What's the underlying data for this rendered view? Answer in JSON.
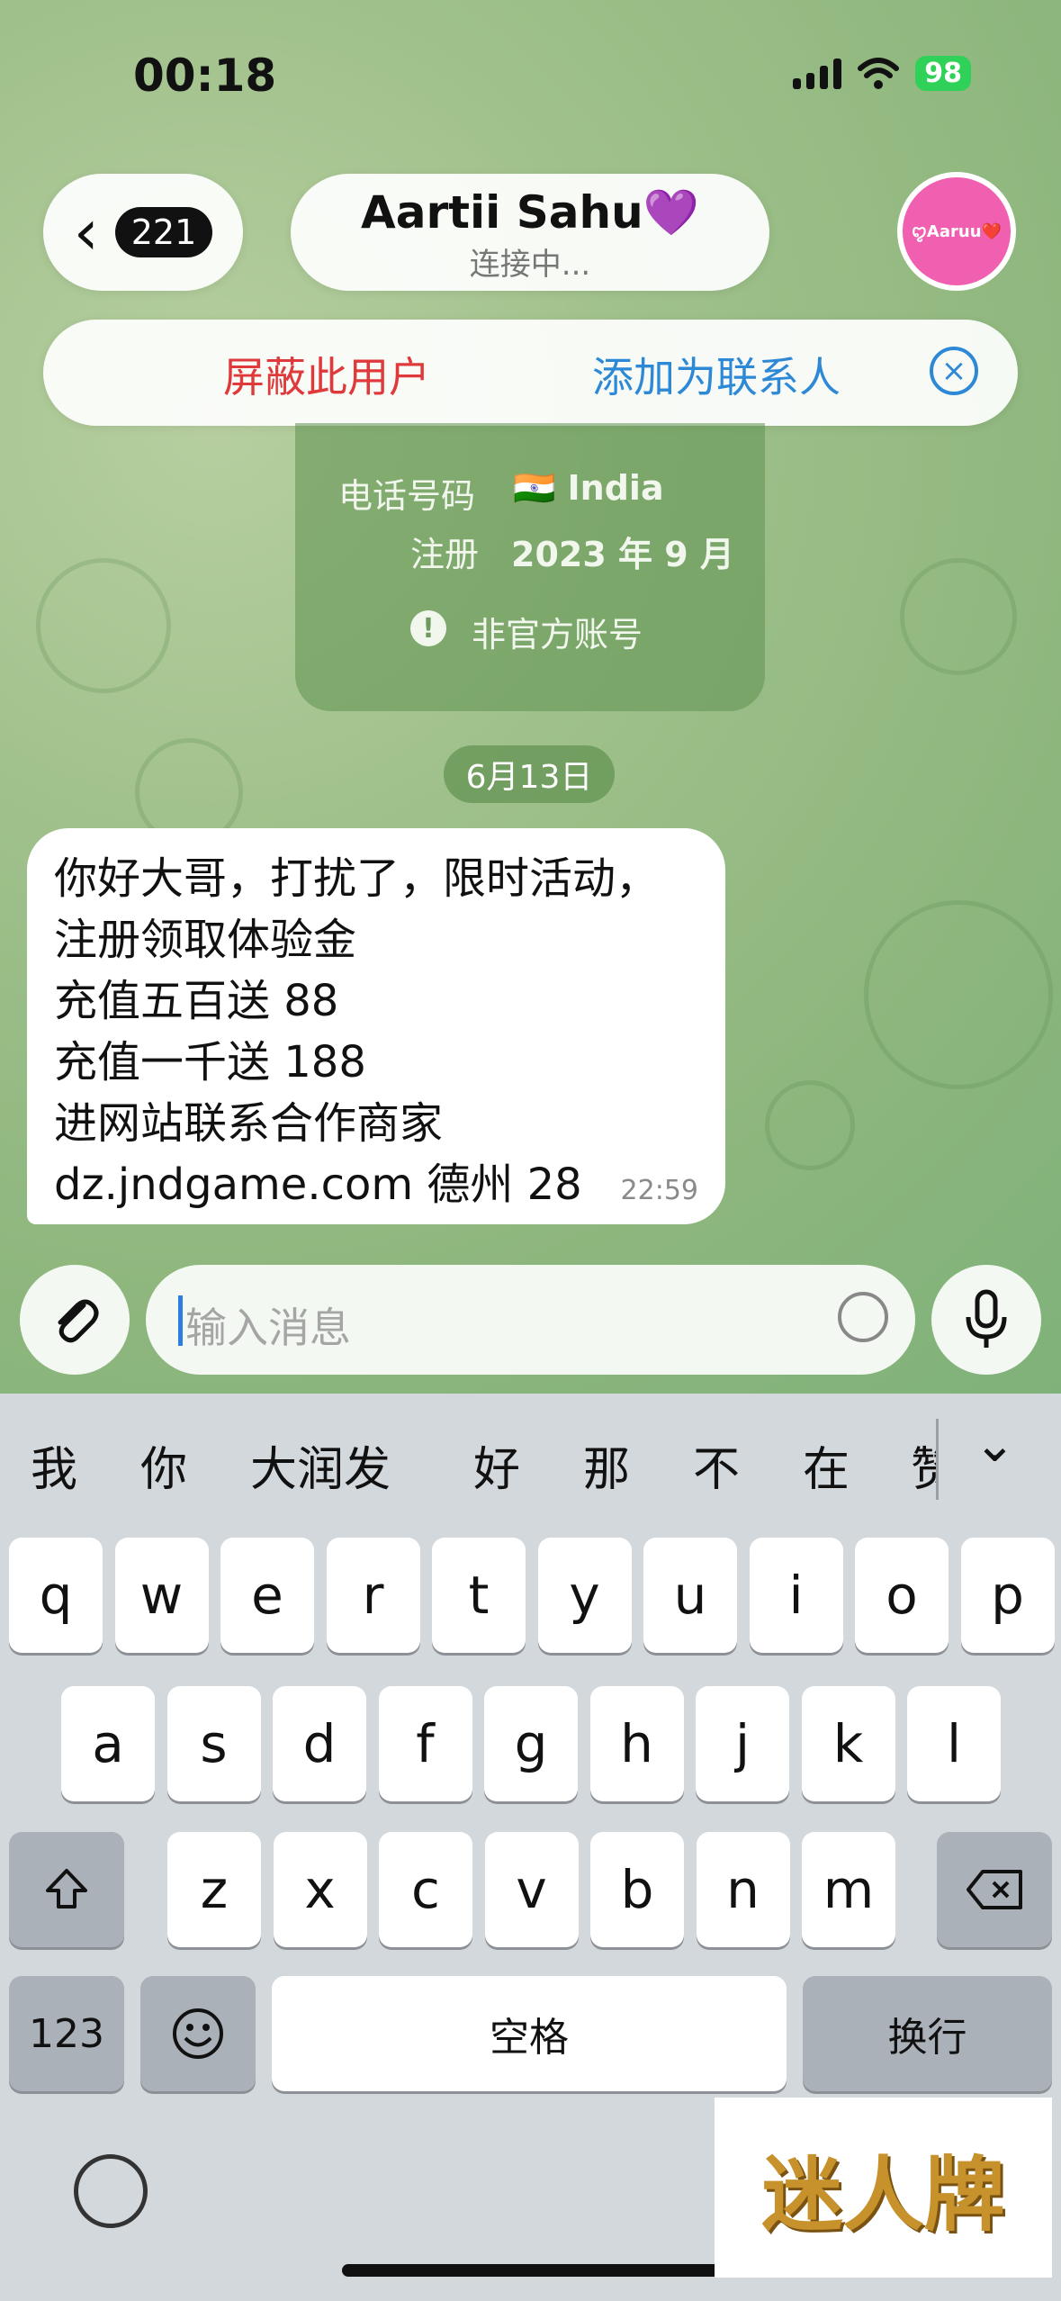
{
  "status_bar": {
    "time": "00:18",
    "battery": "98"
  },
  "header": {
    "back_count": "221",
    "title": "Aartii Sahu💜",
    "subtitle": "连接中...",
    "avatar_text": "ꨄAaruu❤️"
  },
  "action_bar": {
    "block_label": "屏蔽此用户",
    "add_label": "添加为联系人"
  },
  "info_card": {
    "phone_label": "电话号码",
    "phone_value": "🇮🇳 India",
    "registered_label": "注册",
    "registered_value": "2023 年 9 月",
    "notice": "非官方账号"
  },
  "date_chip": "6月13日",
  "message": {
    "lines": [
      "你好大哥，打扰了，限时活动，",
      "注册领取体验金",
      "充值五百送 88",
      "充值一千送 188",
      "进网站联系合作商家",
      " dz.jndgame.com 德州 28"
    ],
    "time": "22:59"
  },
  "input": {
    "placeholder": "输入消息"
  },
  "keyboard": {
    "suggestions": [
      "我",
      "你",
      "大润发",
      "好",
      "那",
      "不",
      "在",
      "赞"
    ],
    "row1": [
      "q",
      "w",
      "e",
      "r",
      "t",
      "y",
      "u",
      "i",
      "o",
      "p"
    ],
    "row2": [
      "a",
      "s",
      "d",
      "f",
      "g",
      "h",
      "j",
      "k",
      "l"
    ],
    "row3": [
      "z",
      "x",
      "c",
      "v",
      "b",
      "n",
      "m"
    ],
    "numbers_label": "123",
    "space_label": "空格",
    "return_label": "换行"
  },
  "watermark": "迷人牌"
}
